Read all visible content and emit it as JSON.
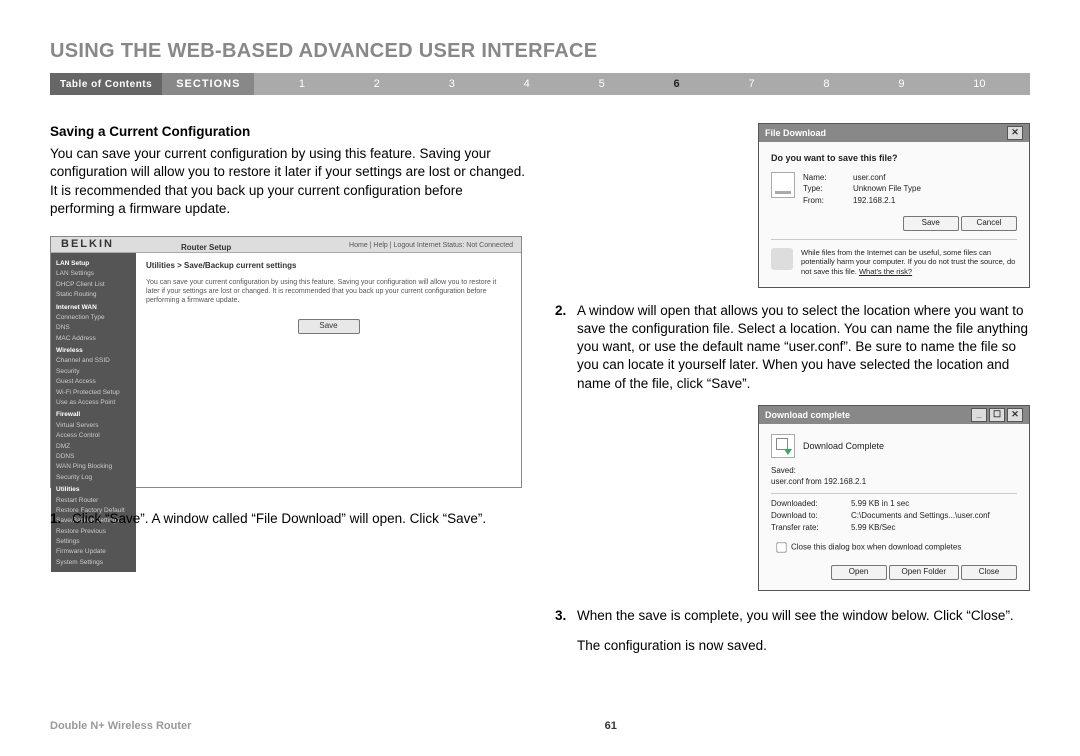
{
  "page_title": "USING THE WEB-BASED ADVANCED USER INTERFACE",
  "nav": {
    "toc": "Table of Contents",
    "sections": "SECTIONS",
    "nums": [
      "1",
      "2",
      "3",
      "4",
      "5",
      "6",
      "7",
      "8",
      "9",
      "10"
    ],
    "active": "6"
  },
  "left": {
    "subhead": "Saving a Current Configuration",
    "intro": "You can save your current configuration by using this feature. Saving your configuration will allow you to restore it later if your settings are lost or changed. It is recommended that you back up your current configuration before performing a firmware update.",
    "step1_num": "1.",
    "step1_body": "Click “Save”. A window called “File Download” will open. Click “Save”."
  },
  "belkin": {
    "logo": "BELKIN",
    "header_title": "Router Setup",
    "header_links": "Home | Help | Logout   Internet Status: Not Connected",
    "breadcrumb": "Utilities > Save/Backup current settings",
    "desc": "You can save your current configuration by using this feature. Saving your configuration will allow you to restore it later if your settings are lost or changed. It is recommended that you back up your current configuration before performing a firmware update.",
    "save_btn": "Save",
    "side": {
      "g1": "LAN Setup",
      "i1": "LAN Settings",
      "i2": "DHCP Client List",
      "i3": "Static Routing",
      "g2": "Internet WAN",
      "i4": "Connection Type",
      "i5": "DNS",
      "i6": "MAC Address",
      "g3": "Wireless",
      "i7": "Channel and SSID",
      "i8": "Security",
      "i9": "Guest Access",
      "i10": "Wi-Fi Protected Setup",
      "i11": "Use as Access Point",
      "g4": "Firewall",
      "i12": "Virtual Servers",
      "i13": "Access Control",
      "i14": "DMZ",
      "i15": "DDNS",
      "i16": "WAN Ping Blocking",
      "i17": "Security Log",
      "g5": "Utilities",
      "i18": "Restart Router",
      "i19": "Restore Factory Default",
      "i20": "Save/Backup Settings",
      "i21": "Restore Previous Settings",
      "i22": "Firmware Update",
      "i23": "System Settings"
    }
  },
  "right": {
    "step2_num": "2.",
    "step2_body": "A window will open that allows you to select the location where you want to save the configuration file. Select a location. You can name the file anything you want, or use the default name “user.conf”. Be sure to name the file so you can locate it yourself later. When you have selected the location and name of the file, click “Save”.",
    "step3_num": "3.",
    "step3_body": "When the save is complete, you will see the window below. Click “Close”.",
    "final": "The configuration is now saved."
  },
  "file_download": {
    "title": "File Download",
    "question": "Do you want to save this file?",
    "name_k": "Name:",
    "name_v": "user.conf",
    "type_k": "Type:",
    "type_v": "Unknown File Type",
    "from_k": "From:",
    "from_v": "192.168.2.1",
    "save": "Save",
    "cancel": "Cancel",
    "warn": "While files from the Internet can be useful, some files can potentially harm your computer. If you do not trust the source, do not save this file.",
    "risk": "What's the risk?"
  },
  "download_complete": {
    "title": "Download complete",
    "heading": "Download Complete",
    "saved_label": "Saved:",
    "saved_val": "user.conf from 192.168.2.1",
    "downloaded_k": "Downloaded:",
    "downloaded_v": "5.99 KB in 1 sec",
    "to_k": "Download to:",
    "to_v": "C:\\Documents and Settings...\\user.conf",
    "rate_k": "Transfer rate:",
    "rate_v": "5.99 KB/Sec",
    "checkbox": "Close this dialog box when download completes",
    "open": "Open",
    "open_folder": "Open Folder",
    "close": "Close"
  },
  "footer": {
    "product": "Double N+ Wireless Router",
    "page": "61"
  }
}
